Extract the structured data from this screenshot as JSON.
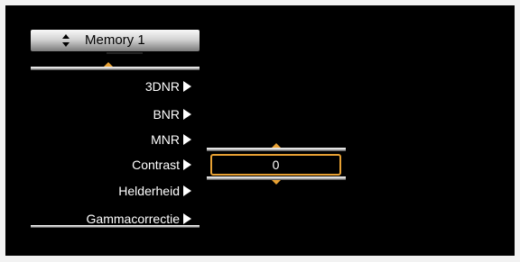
{
  "header": {
    "memory_label": "Memory 1",
    "updown_icon": "up-down-arrows-icon"
  },
  "menu": {
    "items": [
      {
        "label": "3DNR"
      },
      {
        "label": "BNR"
      },
      {
        "label": "MNR"
      },
      {
        "label": "Contrast"
      },
      {
        "label": "Helderheid"
      },
      {
        "label": "Gammacorrectie"
      }
    ],
    "selected": "Contrast"
  },
  "value_popup": {
    "value": "0"
  },
  "colors": {
    "accent": "#e8a133",
    "background": "#000000",
    "text": "#ffffff"
  }
}
